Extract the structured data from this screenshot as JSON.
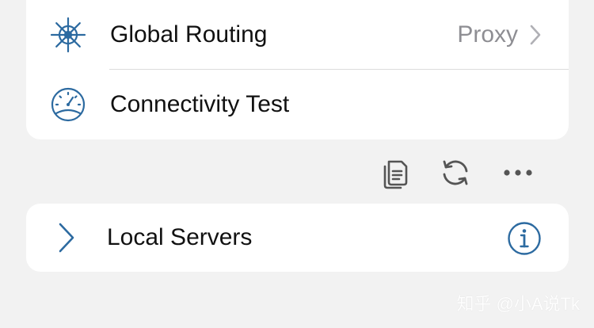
{
  "settings": {
    "global_routing": {
      "label": "Global Routing",
      "value": "Proxy",
      "icon": "ship-wheel-icon"
    },
    "connectivity_test": {
      "label": "Connectivity Test",
      "icon": "speedometer-icon"
    }
  },
  "toolbar": {
    "icons": [
      "copy-icon",
      "refresh-icon",
      "more-icon"
    ]
  },
  "local_servers": {
    "label": "Local Servers",
    "icon": "info-icon"
  },
  "watermark": {
    "text": "知乎 @小A说Tk"
  },
  "colors": {
    "accent": "#2c6aa0",
    "background": "#f2f2f2",
    "card": "#ffffff",
    "secondary_text": "#8e8e93",
    "toolbar_icon": "#555555"
  }
}
